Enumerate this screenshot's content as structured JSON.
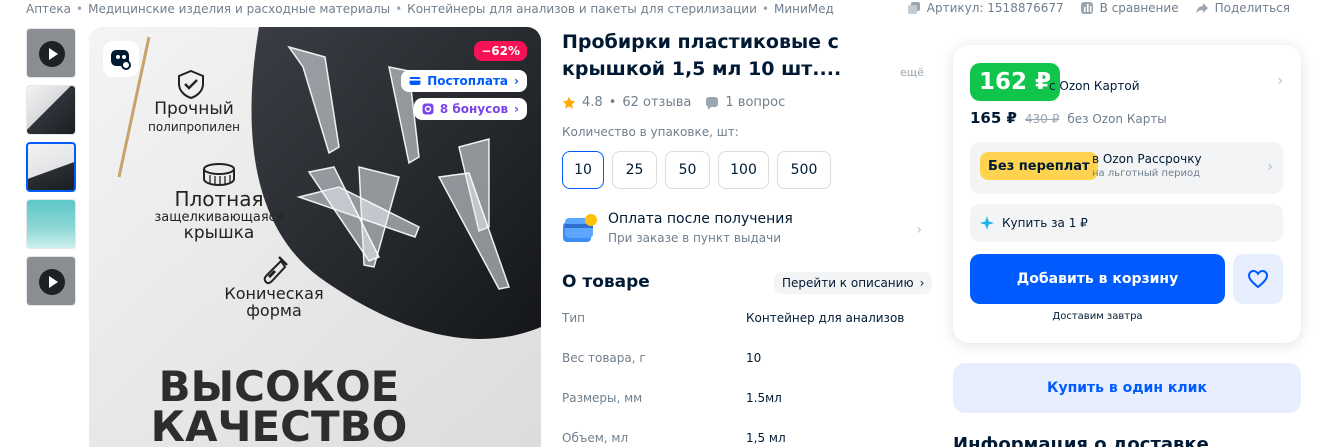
{
  "breadcrumbs": [
    "Аптека",
    "Медицинские изделия и расходные материалы",
    "Контейнеры для анализов и пакеты для стерилизации",
    "МиниМед"
  ],
  "breadcrumb_sep": "•",
  "toplinks": {
    "article": "Артикул: 1518876677",
    "compare": "В сравнение",
    "share": "Поделиться"
  },
  "gallery": {
    "discount": "−62%",
    "postpay": "Постоплата",
    "bonus": "8 бонусов",
    "features": [
      "Прочный",
      "полипропилен",
      "Плотная",
      "защелкивающаяся",
      "крышка",
      "Коническая",
      "форма"
    ],
    "banner": [
      "ВЫСОКОЕ",
      "КАЧЕСТВО"
    ]
  },
  "product": {
    "title": "Пробирки пластиковые с крышкой 1,5 мл 10 шт....",
    "more": "ещё",
    "rating": "4.8",
    "reviews": "62 отзыва",
    "questions": "1 вопрос",
    "qty_label": "Количество в упаковке, шт:",
    "qty_options": [
      "10",
      "25",
      "50",
      "100",
      "500"
    ],
    "pay_title": "Оплата после получения",
    "pay_sub": "При заказе в пункт выдачи",
    "about_title": "О товаре",
    "goto_desc": "Перейти к описанию",
    "specs": [
      {
        "k": "Тип",
        "v": "Контейнер для анализов"
      },
      {
        "k": "Вес товара, г",
        "v": "10"
      },
      {
        "k": "Размеры, мм",
        "v": "1.5мл"
      },
      {
        "k": "Объем, мл",
        "v": "1,5 мл"
      }
    ]
  },
  "price": {
    "main": "162 ₽",
    "main_label": "с Ozon Картой",
    "regular": "165 ₽",
    "old": "430 ₽",
    "regular_label": "без Ozon Карты",
    "installment_badge": "Без переплат",
    "installment_title": "в Ozon Рассрочку",
    "installment_sub": "на льготный период",
    "buy_for": "Купить за 1 ₽",
    "add_to_cart": "Добавить в корзину",
    "delivery": "Доставим завтра",
    "one_click": "Купить в один клик",
    "delivery_info": "Информация о доставке"
  },
  "colors": {
    "accent": "#005bff",
    "green": "#10c44c",
    "discount": "#f91155",
    "yellow": "#ffd34f"
  }
}
